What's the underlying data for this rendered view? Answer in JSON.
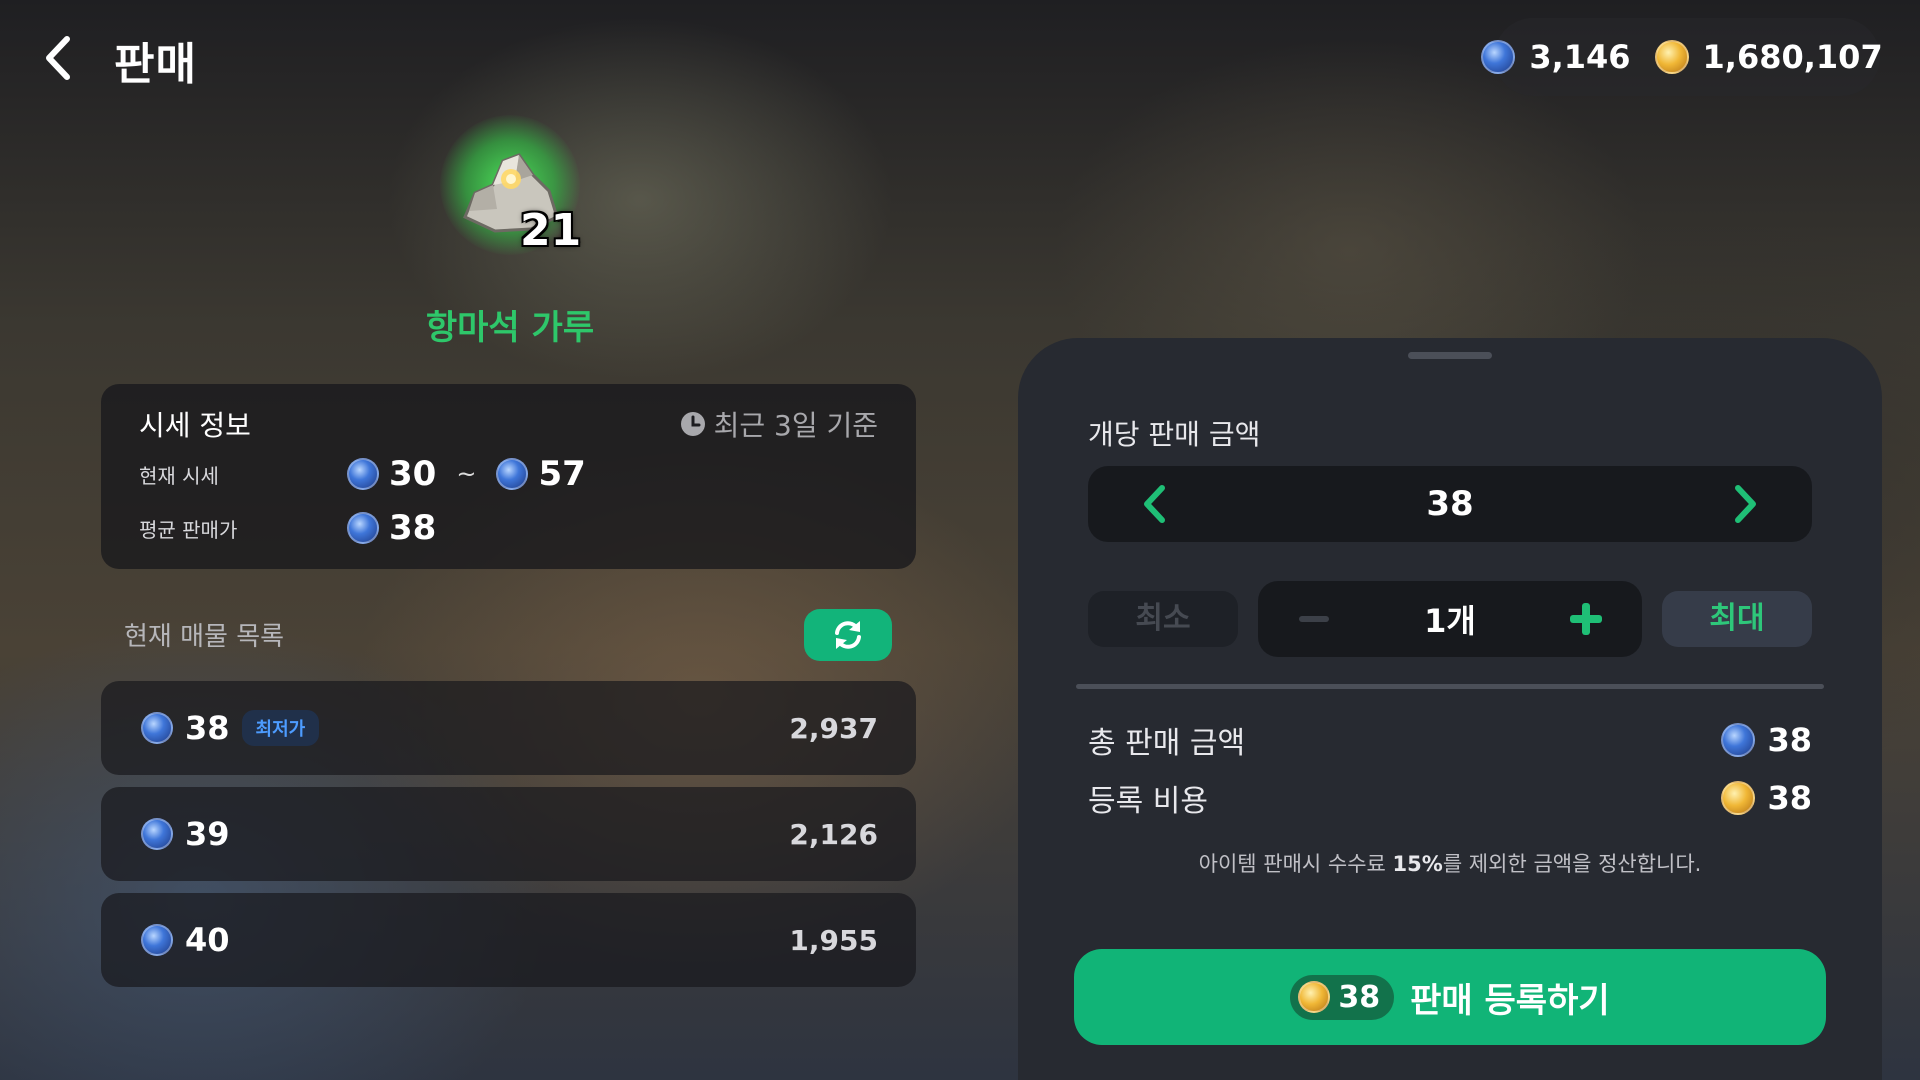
{
  "header": {
    "title": "판매",
    "currencies": [
      {
        "icon": "blue-gem-coin-icon",
        "amount": "3,146"
      },
      {
        "icon": "gold-coin-icon",
        "amount": "1,680,107"
      }
    ]
  },
  "item": {
    "name": "항마석 가루",
    "count": "21",
    "icon": "rock-pile-item-icon",
    "name_color": "#2ec76a"
  },
  "market_info": {
    "title": "시세 정보",
    "period": "최근 3일 기준",
    "current_label": "현재 시세",
    "current_min": "30",
    "current_sep": "~",
    "current_max": "57",
    "average_label": "평균 판매가",
    "average_value": "38"
  },
  "listings": {
    "title": "현재 매물 목록",
    "lowest_badge": "최저가",
    "rows": [
      {
        "price": "38",
        "quantity": "2,937",
        "lowest": true
      },
      {
        "price": "39",
        "quantity": "2,126",
        "lowest": false
      },
      {
        "price": "40",
        "quantity": "1,955",
        "lowest": false
      }
    ]
  },
  "sell": {
    "unit_price_label": "개당 판매 금액",
    "unit_price": "38",
    "min_label": "최소",
    "max_label": "최대",
    "quantity": "1개",
    "total_label": "총 판매 금액",
    "total_value": "38",
    "fee_label": "등록 비용",
    "fee_value": "38",
    "note_prefix": "아이템 판매시 수수료 ",
    "note_percent": "15%",
    "note_suffix": "를 제외한 금액을 정산합니다.",
    "register_cost": "38",
    "register_label": "판매 등록하기"
  },
  "colors": {
    "accent_green": "#11b477",
    "lowest_badge_text": "#4d9cff",
    "panel_bg": "#272a31"
  }
}
